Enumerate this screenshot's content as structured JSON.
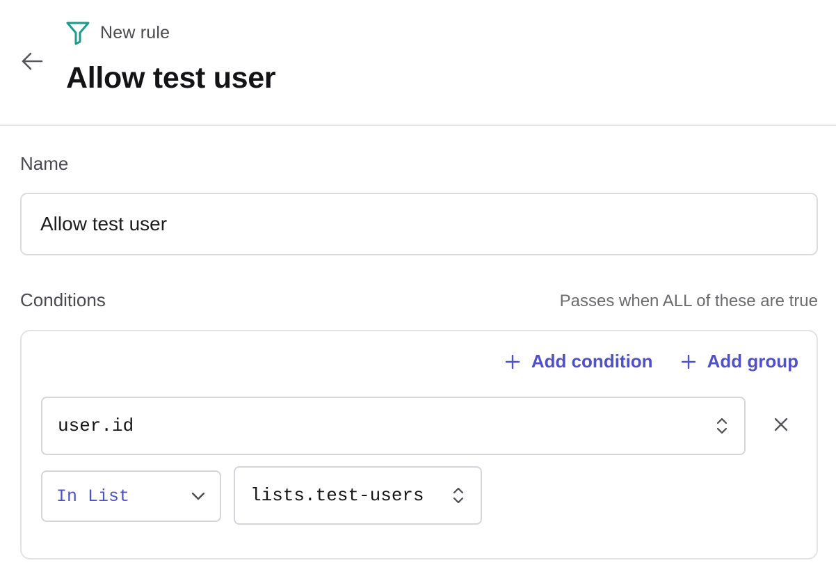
{
  "header": {
    "subtitle": "New rule",
    "title": "Allow test user"
  },
  "name_field": {
    "label": "Name",
    "value": "Allow test user"
  },
  "conditions": {
    "label": "Conditions",
    "hint": "Passes when ALL of these are true",
    "actions": {
      "add_condition": "Add condition",
      "add_group": "Add group"
    },
    "items": [
      {
        "field": "user.id",
        "operator": "In List",
        "value": "lists.test-users"
      }
    ]
  },
  "colors": {
    "accent": "#5051c7",
    "filter_icon": "#1f9a8a",
    "border": "#d6d6da",
    "muted_text": "#4a4a4f"
  },
  "icons": {
    "back": "arrow-left-icon",
    "subtitle": "filter-icon",
    "add": "plus-icon",
    "select": "sort-icon",
    "remove": "close-icon",
    "dropdown": "chevron-down-icon"
  }
}
